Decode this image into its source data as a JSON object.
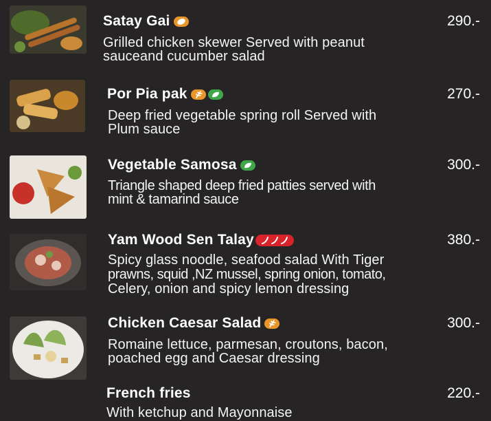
{
  "menu": {
    "items": [
      {
        "name": "Satay Gai",
        "price": "290.-",
        "desc_lines": [
          "Grilled chicken skewer Served with peanut",
          "sauceand cucumber salad"
        ],
        "icons": [
          "peanut-icon"
        ]
      },
      {
        "name": "Por Pia pak",
        "price": "270.-",
        "desc_lines": [
          "Deep fried vegetable spring roll Served with",
          "Plum sauce"
        ],
        "icons": [
          "gluten-icon",
          "vegetarian-icon"
        ]
      },
      {
        "name": "Vegetable Samosa",
        "price": "300.-",
        "desc_lines": [
          "Triangle shaped deep fried patties served with",
          "mint & tamarind sauce"
        ],
        "icons": [
          "vegetarian-icon"
        ]
      },
      {
        "name": "Yam Wood Sen Talay",
        "price": "380.-",
        "desc_lines": [
          "Spicy glass noodle, seafood salad With Tiger",
          "prawns, squid ,NZ mussel, spring onion, tomato,",
          "Celery, onion  and spicy lemon dressing"
        ],
        "icons": [
          "chili-spicy-icon"
        ]
      },
      {
        "name": "Chicken Caesar Salad",
        "price": "300.-",
        "desc_lines": [
          "Romaine lettuce, parmesan, croutons, bacon,",
          "poached egg and Caesar dressing"
        ],
        "icons": [
          "gluten-icon"
        ]
      },
      {
        "name": "French fries",
        "price": "220.-",
        "desc_lines": [
          "With ketchup and Mayonnaise"
        ],
        "icons": []
      }
    ]
  },
  "colors": {
    "background": "#262424",
    "text": "#ffffff",
    "badge_orange": "#e8962a",
    "badge_green": "#3fa64a",
    "badge_red": "#d8232a"
  }
}
